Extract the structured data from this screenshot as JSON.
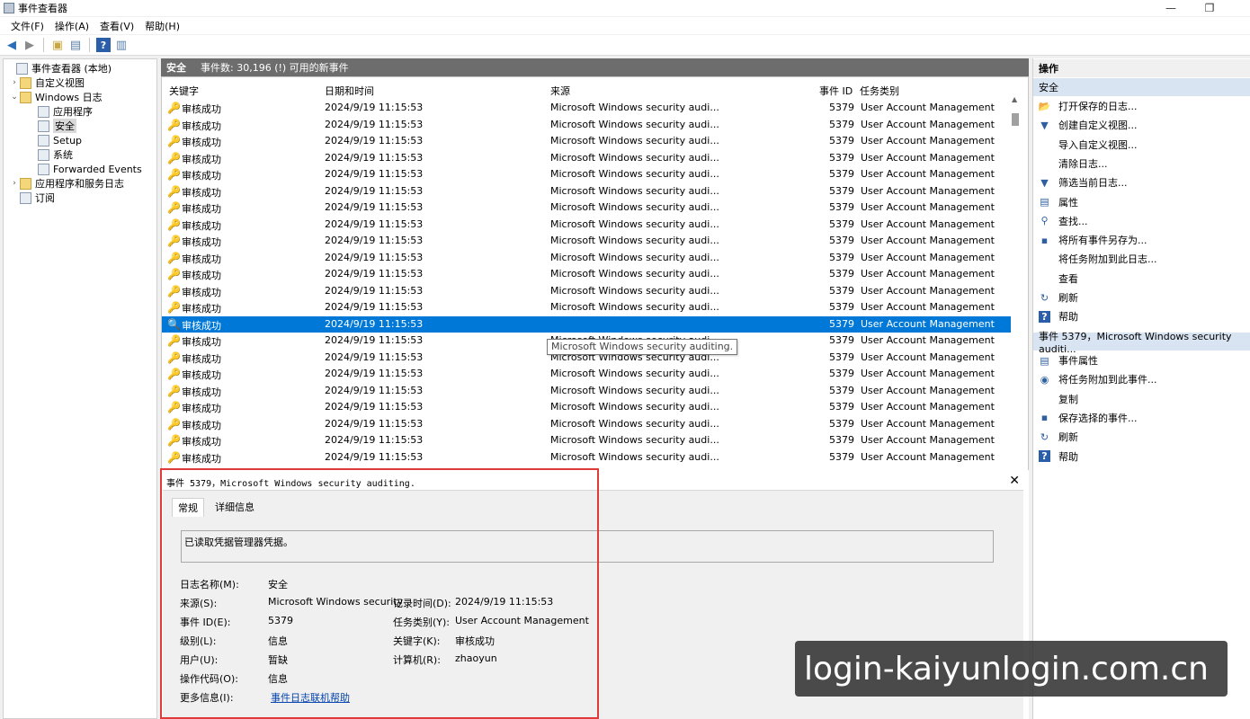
{
  "window": {
    "title": "事件查看器",
    "controls": [
      "—",
      "❐",
      "✕"
    ]
  },
  "menubar": [
    "文件(F)",
    "操作(A)",
    "查看(V)",
    "帮助(H)"
  ],
  "toolbar": {
    "buttons": [
      "back-arrow-icon",
      "forward-arrow-icon",
      "folder-up-icon",
      "properties-icon",
      "help-icon",
      "panel-icon"
    ]
  },
  "tree": {
    "items": [
      {
        "label": "事件查看器 (本地)",
        "level": 0,
        "arrow": ""
      },
      {
        "label": "自定义视图",
        "level": 1,
        "arrow": "›"
      },
      {
        "label": "Windows 日志",
        "level": 1,
        "arrow": "⌄"
      },
      {
        "label": "应用程序",
        "level": 2,
        "arrow": ""
      },
      {
        "label": "安全",
        "level": 2,
        "arrow": "",
        "selected": true
      },
      {
        "label": "Setup",
        "level": 2,
        "arrow": ""
      },
      {
        "label": "系统",
        "level": 2,
        "arrow": ""
      },
      {
        "label": "Forwarded Events",
        "level": 2,
        "arrow": ""
      },
      {
        "label": "应用程序和服务日志",
        "level": 1,
        "arrow": "›"
      },
      {
        "label": "订阅",
        "level": 1,
        "arrow": ""
      }
    ]
  },
  "list": {
    "header_title": "安全",
    "header_info": "事件数: 30,196 (!) 可用的新事件",
    "columns": [
      "关键字",
      "日期和时间",
      "来源",
      "事件 ID",
      "任务类别"
    ],
    "rows": [
      {
        "keyword": "审核成功",
        "datetime": "2024/9/19 11:15:53",
        "source": "Microsoft Windows security audi...",
        "id": "5379",
        "task": "User Account Management"
      },
      {
        "keyword": "审核成功",
        "datetime": "2024/9/19 11:15:53",
        "source": "Microsoft Windows security audi...",
        "id": "5379",
        "task": "User Account Management"
      },
      {
        "keyword": "审核成功",
        "datetime": "2024/9/19 11:15:53",
        "source": "Microsoft Windows security audi...",
        "id": "5379",
        "task": "User Account Management"
      },
      {
        "keyword": "审核成功",
        "datetime": "2024/9/19 11:15:53",
        "source": "Microsoft Windows security audi...",
        "id": "5379",
        "task": "User Account Management"
      },
      {
        "keyword": "审核成功",
        "datetime": "2024/9/19 11:15:53",
        "source": "Microsoft Windows security audi...",
        "id": "5379",
        "task": "User Account Management"
      },
      {
        "keyword": "审核成功",
        "datetime": "2024/9/19 11:15:53",
        "source": "Microsoft Windows security audi...",
        "id": "5379",
        "task": "User Account Management"
      },
      {
        "keyword": "审核成功",
        "datetime": "2024/9/19 11:15:53",
        "source": "Microsoft Windows security audi...",
        "id": "5379",
        "task": "User Account Management"
      },
      {
        "keyword": "审核成功",
        "datetime": "2024/9/19 11:15:53",
        "source": "Microsoft Windows security audi...",
        "id": "5379",
        "task": "User Account Management"
      },
      {
        "keyword": "审核成功",
        "datetime": "2024/9/19 11:15:53",
        "source": "Microsoft Windows security audi...",
        "id": "5379",
        "task": "User Account Management"
      },
      {
        "keyword": "审核成功",
        "datetime": "2024/9/19 11:15:53",
        "source": "Microsoft Windows security audi...",
        "id": "5379",
        "task": "User Account Management"
      },
      {
        "keyword": "审核成功",
        "datetime": "2024/9/19 11:15:53",
        "source": "Microsoft Windows security audi...",
        "id": "5379",
        "task": "User Account Management"
      },
      {
        "keyword": "审核成功",
        "datetime": "2024/9/19 11:15:53",
        "source": "Microsoft Windows security audi...",
        "id": "5379",
        "task": "User Account Management"
      },
      {
        "keyword": "审核成功",
        "datetime": "2024/9/19 11:15:53",
        "source": "Microsoft Windows security audi...",
        "id": "5379",
        "task": "User Account Management"
      },
      {
        "keyword": "审核成功",
        "datetime": "2024/9/19 11:15:53",
        "source": "",
        "id": "5379",
        "task": "User Account Management",
        "selected": true
      },
      {
        "keyword": "审核成功",
        "datetime": "2024/9/19 11:15:53",
        "source": "Microsoft Windows security audi...",
        "id": "5379",
        "task": "User Account Management"
      },
      {
        "keyword": "审核成功",
        "datetime": "2024/9/19 11:15:53",
        "source": "Microsoft Windows security audi...",
        "id": "5379",
        "task": "User Account Management"
      },
      {
        "keyword": "审核成功",
        "datetime": "2024/9/19 11:15:53",
        "source": "Microsoft Windows security audi...",
        "id": "5379",
        "task": "User Account Management"
      },
      {
        "keyword": "审核成功",
        "datetime": "2024/9/19 11:15:53",
        "source": "Microsoft Windows security audi...",
        "id": "5379",
        "task": "User Account Management"
      },
      {
        "keyword": "审核成功",
        "datetime": "2024/9/19 11:15:53",
        "source": "Microsoft Windows security audi...",
        "id": "5379",
        "task": "User Account Management"
      },
      {
        "keyword": "审核成功",
        "datetime": "2024/9/19 11:15:53",
        "source": "Microsoft Windows security audi...",
        "id": "5379",
        "task": "User Account Management"
      },
      {
        "keyword": "审核成功",
        "datetime": "2024/9/19 11:15:53",
        "source": "Microsoft Windows security audi...",
        "id": "5379",
        "task": "User Account Management"
      },
      {
        "keyword": "审核成功",
        "datetime": "2024/9/19 11:15:53",
        "source": "Microsoft Windows security audi...",
        "id": "5379",
        "task": "User Account Management"
      }
    ],
    "tooltip": "Microsoft Windows security auditing."
  },
  "detail": {
    "title": "事件 5379，Microsoft Windows security auditing.",
    "close": "✕",
    "tabs": [
      "常规",
      "详细信息"
    ],
    "description": "已读取凭据管理器凭据。",
    "props": [
      {
        "label": "日志名称(M):",
        "value": "安全"
      },
      {
        "label": "来源(S):",
        "value": "Microsoft Windows security"
      },
      {
        "label": "事件 ID(E):",
        "value": "5379"
      },
      {
        "label": "级别(L):",
        "value": "信息"
      },
      {
        "label": "用户(U):",
        "value": "暂缺"
      },
      {
        "label": "操作代码(O):",
        "value": "信息"
      },
      {
        "label": "更多信息(I):",
        "value": "事件日志联机帮助"
      }
    ],
    "props2": [
      {
        "label": "记录时间(D):",
        "value": "2024/9/19 11:15:53"
      },
      {
        "label": "任务类别(Y):",
        "value": "User Account Management"
      },
      {
        "label": "关键字(K):",
        "value": "审核成功"
      },
      {
        "label": "计算机(R):",
        "value": "zhaoyun"
      }
    ]
  },
  "actions": {
    "header": "操作",
    "section1": "安全",
    "items1": [
      {
        "label": "打开保存的日志...",
        "icon": "open-folder-icon"
      },
      {
        "label": "创建自定义视图...",
        "icon": "filter-icon"
      },
      {
        "label": "导入自定义视图...",
        "icon": ""
      },
      {
        "label": "清除日志...",
        "icon": ""
      },
      {
        "label": "筛选当前日志...",
        "icon": "filter-icon"
      },
      {
        "label": "属性",
        "icon": "properties-icon"
      },
      {
        "label": "查找...",
        "icon": "binoculars-icon"
      },
      {
        "label": "将所有事件另存为...",
        "icon": "save-icon"
      },
      {
        "label": "将任务附加到此日志...",
        "icon": ""
      },
      {
        "label": "查看",
        "icon": ""
      },
      {
        "label": "刷新",
        "icon": "refresh-icon"
      },
      {
        "label": "帮助",
        "icon": "help-icon"
      }
    ],
    "section2": "事件 5379，Microsoft Windows security auditi...",
    "items2": [
      {
        "label": "事件属性",
        "icon": "properties-icon"
      },
      {
        "label": "将任务附加到此事件...",
        "icon": "task-icon"
      },
      {
        "label": "复制",
        "icon": ""
      },
      {
        "label": "保存选择的事件...",
        "icon": "save-icon"
      },
      {
        "label": "刷新",
        "icon": "refresh-icon"
      },
      {
        "label": "帮助",
        "icon": "help-icon"
      }
    ]
  },
  "watermark": "login-kaiyunlogin.com.cn"
}
